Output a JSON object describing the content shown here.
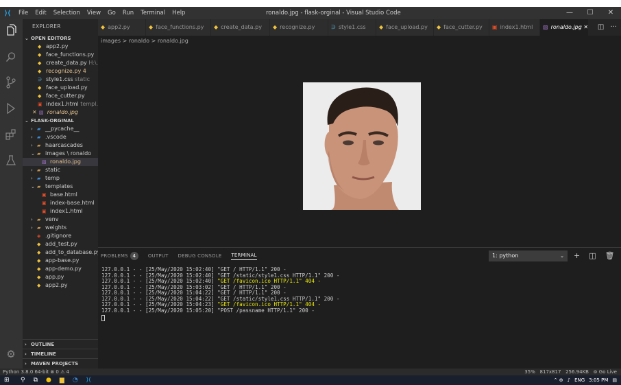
{
  "titlebar": {
    "menu": [
      "File",
      "Edit",
      "Selection",
      "View",
      "Go",
      "Run",
      "Terminal",
      "Help"
    ],
    "title": "ronaldo.jpg - flask-orginal - Visual Studio Code",
    "min": "—",
    "max": "☐",
    "close": "✕"
  },
  "sidebar": {
    "title": "EXPLORER",
    "open_editors_header": "OPEN EDITORS",
    "open_editors": [
      {
        "name": "app2.py",
        "hint": "",
        "type": "py"
      },
      {
        "name": "face_functions.py",
        "hint": "",
        "type": "py"
      },
      {
        "name": "create_data.py",
        "hint": "H:\\...",
        "type": "py"
      },
      {
        "name": "recognize.py",
        "hint": "4",
        "type": "py-mod"
      },
      {
        "name": "style1.css",
        "hint": "static",
        "type": "css"
      },
      {
        "name": "face_upload.py",
        "hint": "",
        "type": "py"
      },
      {
        "name": "face_cutter.py",
        "hint": "",
        "type": "py"
      },
      {
        "name": "index1.html",
        "hint": "templ...",
        "type": "html"
      },
      {
        "name": "ronaldo.jpg",
        "hint": "",
        "type": "img-active"
      }
    ],
    "project_header": "FLASK-ORGINAL",
    "tree": [
      {
        "name": "__pycache__",
        "type": "folder-blue",
        "indent": 1,
        "chev": "›"
      },
      {
        "name": ".vscode",
        "type": "folder-blue",
        "indent": 1,
        "chev": "›"
      },
      {
        "name": "haarcascades",
        "type": "folder",
        "indent": 1,
        "chev": "›"
      },
      {
        "name": "images \\ ronaldo",
        "type": "folder",
        "indent": 1,
        "chev": "⌄"
      },
      {
        "name": "ronaldo.jpg",
        "type": "img",
        "indent": 2,
        "chev": "",
        "selected": true
      },
      {
        "name": "static",
        "type": "folder",
        "indent": 1,
        "chev": "›"
      },
      {
        "name": "temp",
        "type": "folder-blue",
        "indent": 1,
        "chev": "›"
      },
      {
        "name": "templates",
        "type": "folder",
        "indent": 1,
        "chev": "⌄"
      },
      {
        "name": "base.html",
        "type": "html",
        "indent": 2,
        "chev": ""
      },
      {
        "name": "index-base.html",
        "type": "html",
        "indent": 2,
        "chev": ""
      },
      {
        "name": "index1.html",
        "type": "html",
        "indent": 2,
        "chev": ""
      },
      {
        "name": "venv",
        "type": "folder",
        "indent": 1,
        "chev": "›"
      },
      {
        "name": "weights",
        "type": "folder",
        "indent": 1,
        "chev": "›"
      },
      {
        "name": ".gitignore",
        "type": "git",
        "indent": 1,
        "chev": ""
      },
      {
        "name": "add_test.py",
        "type": "py",
        "indent": 1,
        "chev": ""
      },
      {
        "name": "add_to_database.py",
        "type": "py",
        "indent": 1,
        "chev": ""
      },
      {
        "name": "app-base.py",
        "type": "py",
        "indent": 1,
        "chev": ""
      },
      {
        "name": "app-demo.py",
        "type": "py",
        "indent": 1,
        "chev": ""
      },
      {
        "name": "app.py",
        "type": "py",
        "indent": 1,
        "chev": ""
      },
      {
        "name": "app2.py",
        "type": "py",
        "indent": 1,
        "chev": ""
      }
    ],
    "outline": "OUTLINE",
    "timeline": "TIMELINE",
    "maven": "MAVEN PROJECTS"
  },
  "tabs": [
    {
      "label": "app2.py",
      "type": "py"
    },
    {
      "label": "face_functions.py",
      "type": "py"
    },
    {
      "label": "create_data.py",
      "type": "py"
    },
    {
      "label": "recognize.py",
      "type": "py"
    },
    {
      "label": "style1.css",
      "type": "css"
    },
    {
      "label": "face_upload.py",
      "type": "py"
    },
    {
      "label": "face_cutter.py",
      "type": "py"
    },
    {
      "label": "index1.html",
      "type": "html"
    },
    {
      "label": "ronaldo.jpg",
      "type": "img",
      "active": true
    }
  ],
  "breadcrumb": "images > ronaldo > ronaldo.jpg",
  "panel": {
    "tabs": [
      "PROBLEMS",
      "OUTPUT",
      "DEBUG CONSOLE",
      "TERMINAL"
    ],
    "problems_count": "4",
    "terminal_select": "1: python",
    "log": [
      {
        "prefix": "127.0.0.1 - - [25/May/2020 15:02:40] ",
        "req": "\"GET / HTTP/1.1\" 200 -",
        "warn": false
      },
      {
        "prefix": "127.0.0.1 - - [25/May/2020 15:02:40] ",
        "req": "\"GET /static/style1.css HTTP/1.1\" 200 -",
        "warn": false
      },
      {
        "prefix": "127.0.0.1 - - [25/May/2020 15:02:40] ",
        "req": "\"GET /favicon.ico HTTP/1.1\" 404 -",
        "warn": true
      },
      {
        "prefix": "127.0.0.1 - - [25/May/2020 15:03:02] ",
        "req": "\"GET / HTTP/1.1\" 200 -",
        "warn": false
      },
      {
        "prefix": "127.0.0.1 - - [25/May/2020 15:04:22] ",
        "req": "\"GET / HTTP/1.1\" 200 -",
        "warn": false
      },
      {
        "prefix": "127.0.0.1 - - [25/May/2020 15:04:22] ",
        "req": "\"GET /static/style1.css HTTP/1.1\" 200 -",
        "warn": false
      },
      {
        "prefix": "127.0.0.1 - - [25/May/2020 15:04:23] ",
        "req": "\"GET /favicon.ico HTTP/1.1\" 404 -",
        "warn": true
      },
      {
        "prefix": "127.0.0.1 - - [25/May/2020 15:05:20] ",
        "req": "\"POST /passname HTTP/1.1\" 200 -",
        "warn": false
      }
    ]
  },
  "statusbar": {
    "left": "Python 3.8.0 64-bit   ⊗ 0 ⚠ 4",
    "right": "35%   817x817   256.94KB   Go Live",
    "zoom": "35%",
    "dims": "817x817",
    "size": "256.94KB",
    "golive": "Go Live"
  },
  "taskbar": {
    "lang": "ENG",
    "time": "3:05 PM"
  },
  "colors": {
    "editor_bg": "#1e1e1e",
    "sidebar_bg": "#252526",
    "activity_bg": "#333333",
    "warn_yellow": "#e5e510"
  }
}
